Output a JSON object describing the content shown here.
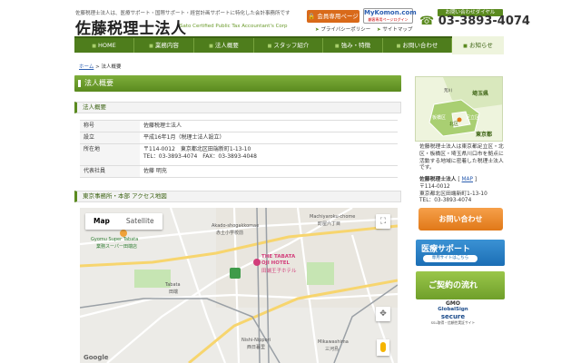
{
  "header": {
    "tagline": "佐藤税理士法人は、医療サポート・国際サポート・経営計画サポートに特化した会計事務所です",
    "logo": "佐藤税理士法人",
    "logo_sub": "Sato Certified Public Tax Accountant's Corp",
    "members_button": "会員専用ページ",
    "mykomon_title": "MyKomon.com",
    "mykomon_sub": "顧客専用ページログイン",
    "tel_label": "お問い合わせダイヤル",
    "tel_number": "03-3893-4074",
    "privacy_link": "プライバシーポリシー",
    "sitemap_link": "サイトマップ"
  },
  "nav": {
    "items": [
      {
        "label": "HOME"
      },
      {
        "label": "業務内容"
      },
      {
        "label": "法人概要"
      },
      {
        "label": "スタッフ紹介"
      },
      {
        "label": "強み・特徴"
      },
      {
        "label": "お問い合わせ"
      },
      {
        "label": "お知らせ"
      }
    ],
    "active_index": 6
  },
  "breadcrumb": {
    "home": "ホーム",
    "separator": ">",
    "current": "法人概要"
  },
  "main": {
    "page_title": "法人概要",
    "section1_title": "法人概要",
    "info_rows": [
      {
        "key": "称号",
        "value": "佐藤税理士法人"
      },
      {
        "key": "設立",
        "value": "平成16年1月（税理士法人設立）"
      },
      {
        "key": "所在地",
        "value_lines": [
          "〒114-0012　東京都北区田端新町1-13-10",
          "TEL：03-3893-4074　FAX：03-3893-4048"
        ]
      },
      {
        "key": "代表社員",
        "value": "佐藤 明充"
      }
    ],
    "section2_title": "東京事務所・本部 アクセス地図"
  },
  "map": {
    "tab_map": "Map",
    "tab_satellite": "Satellite",
    "labels": {
      "akado": "Akado-shogakkomae",
      "akado_jp": "赤土小学校前",
      "machiya": "Machiyaroku-chome",
      "machiya_jp": "町屋六丁目",
      "tabata": "Tabata",
      "tabata_jp": "田端",
      "nishi": "Nishi-Nippori",
      "nishi_jp": "西日暮里",
      "mikawa": "Mikawashima",
      "mikawa_jp": "三河島",
      "gyomu": "Gyomu Super Tabata",
      "gyomu_jp": "業務スーパー田端店",
      "hotel1": "THE TABATA",
      "hotel2": "OJI HOTEL",
      "hotel_jp": "田端王子ホテル",
      "google": "Google"
    }
  },
  "sidebar": {
    "map_labels": {
      "arakawa": "荒川",
      "saitama": "埼玉県",
      "itabashi": "板橋区",
      "adachi": "足立区",
      "kita": "北区",
      "tokyo": "東京都"
    },
    "description": "佐藤税理士法人は東京都足立区・北区・板橋区・埼玉県川口市を拠点に活動する地域に密着した税理士法人です。",
    "company_name": "佐藤税理士法人",
    "map_link": "MAP",
    "postal": "〒114-0012",
    "address": "東京都北区田端新町1-13-10",
    "tel": "TEL：03-3893-4074",
    "contact_button": "お問い合わせ",
    "medical_banner": "医療サポート",
    "medical_banner_sub": "専用サイトはこちら",
    "contract_banner": "ご契約の流れ",
    "gs_a": "GMO",
    "gs_b": "GlobalSign",
    "gs_c": "secure",
    "gs_d": "SSL取得・信頼性実証サイト"
  },
  "colors": {
    "brand_green": "#5a8a1f",
    "nav_green": "#4e7d1c",
    "accent_orange": "#e07818",
    "link_blue": "#2a5db0",
    "medical_blue": "#1b6eb5"
  }
}
